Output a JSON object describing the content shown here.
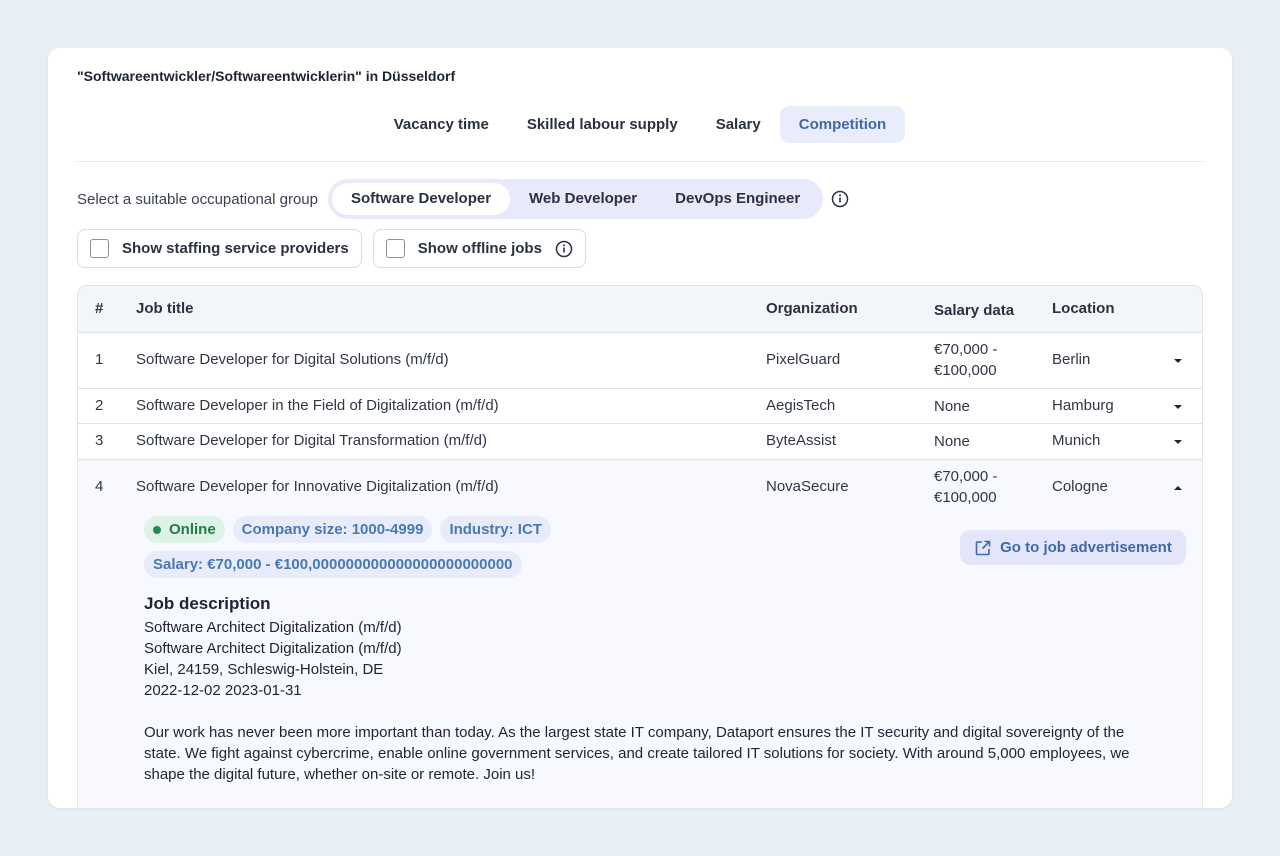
{
  "page": {
    "title": "\"Softwareentwickler/Softwareentwicklerin\" in Düsseldorf"
  },
  "tabs": [
    {
      "label": "Vacancy time"
    },
    {
      "label": "Skilled labour supply"
    },
    {
      "label": "Salary"
    },
    {
      "label": "Competition",
      "active": true
    }
  ],
  "occupational_group": {
    "label": "Select a suitable occupational group",
    "options": [
      {
        "label": "Software Developer",
        "active": true
      },
      {
        "label": "Web Developer"
      },
      {
        "label": "DevOps Engineer"
      }
    ]
  },
  "filters": {
    "staffing": {
      "label": "Show staffing service providers",
      "checked": false
    },
    "offline": {
      "label": "Show offline jobs",
      "checked": false
    }
  },
  "table": {
    "headers": {
      "num": "#",
      "title": "Job title",
      "org": "Organization",
      "salary": "Salary data",
      "location": "Location"
    },
    "rows": [
      {
        "num": "1",
        "title": "Software Developer for Digital Solutions (m/f/d)",
        "org": "PixelGuard",
        "salary": "€70,000 - €100,000",
        "location": "Berlin"
      },
      {
        "num": "2",
        "title": "Software Developer in the Field of Digitalization (m/f/d)",
        "org": "AegisTech",
        "salary": "None",
        "location": "Hamburg"
      },
      {
        "num": "3",
        "title": "Software Developer for Digital Transformation (m/f/d)",
        "org": "ByteAssist",
        "salary": "None",
        "location": "Munich"
      },
      {
        "num": "4",
        "title": "Software Developer for Innovative Digitalization (m/f/d)",
        "org": "NovaSecure",
        "salary": "€70,000 - €100,000",
        "location": "Cologne"
      }
    ]
  },
  "details": {
    "chips": {
      "status": "Online",
      "company_size": "Company size: 1000-4999",
      "industry": "Industry: ICT",
      "salary": "Salary: €70,000 - €100,000000000000000000000000"
    },
    "go_button": "Go to job advertisement",
    "description_heading": "Job description",
    "lines": [
      "Software Architect Digitalization (m/f/d)",
      "Software Architect Digitalization (m/f/d)",
      "Kiel, 24159, Schleswig-Holstein, DE",
      "2022-12-02 2023-01-31"
    ],
    "paragraph": "Our work has never been more important than today. As the largest state IT company, Dataport ensures the IT security and digital sovereignty of the state. We fight against cybercrime, enable online government services, and create tailored IT solutions for society. With around 5,000 employees, we shape the digital future, whether on-site or remote. Join us!"
  },
  "colors": {
    "accent": "#4268a8",
    "online_green": "#237a4b"
  }
}
